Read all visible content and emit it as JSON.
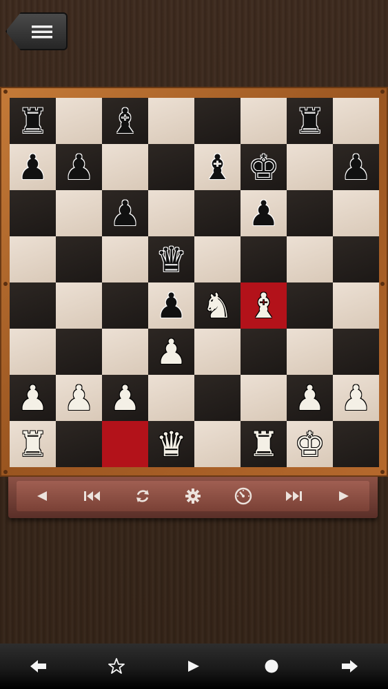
{
  "menu": {
    "icon": "hamburger-menu-icon"
  },
  "board": {
    "light_color": "#e5d8c9",
    "dark_color": "#231e1b",
    "highlight_color": "#b3121a",
    "highlights": [
      "f4",
      "c1"
    ],
    "pieces": [
      {
        "square": "a8",
        "color": "b",
        "type": "R",
        "glyph": "♜"
      },
      {
        "square": "c8",
        "color": "b",
        "type": "B",
        "glyph": "♝"
      },
      {
        "square": "g8",
        "color": "b",
        "type": "R",
        "glyph": "♜"
      },
      {
        "square": "a7",
        "color": "b",
        "type": "P",
        "glyph": "♟"
      },
      {
        "square": "b7",
        "color": "b",
        "type": "P",
        "glyph": "♟"
      },
      {
        "square": "e7",
        "color": "b",
        "type": "B",
        "glyph": "♝"
      },
      {
        "square": "f7",
        "color": "b",
        "type": "K",
        "glyph": "♚"
      },
      {
        "square": "h7",
        "color": "b",
        "type": "P",
        "glyph": "♟"
      },
      {
        "square": "c6",
        "color": "b",
        "type": "P",
        "glyph": "♟"
      },
      {
        "square": "f6",
        "color": "b",
        "type": "P",
        "glyph": "♟"
      },
      {
        "square": "d5",
        "color": "b",
        "type": "Q",
        "glyph": "♛"
      },
      {
        "square": "d4",
        "color": "b",
        "type": "P",
        "glyph": "♟"
      },
      {
        "square": "e4",
        "color": "w",
        "type": "N",
        "glyph": "♞"
      },
      {
        "square": "f4",
        "color": "w",
        "type": "B",
        "glyph": "♝"
      },
      {
        "square": "d3",
        "color": "w",
        "type": "P",
        "glyph": "♟"
      },
      {
        "square": "a2",
        "color": "w",
        "type": "P",
        "glyph": "♟"
      },
      {
        "square": "b2",
        "color": "w",
        "type": "P",
        "glyph": "♟"
      },
      {
        "square": "c2",
        "color": "w",
        "type": "P",
        "glyph": "♟"
      },
      {
        "square": "g2",
        "color": "w",
        "type": "P",
        "glyph": "♟"
      },
      {
        "square": "h2",
        "color": "w",
        "type": "P",
        "glyph": "♟"
      },
      {
        "square": "a1",
        "color": "w",
        "type": "R",
        "glyph": "♜"
      },
      {
        "square": "d1",
        "color": "w",
        "type": "Q",
        "glyph": "♛"
      },
      {
        "square": "f1",
        "color": "w",
        "type": "R",
        "glyph": "♜"
      },
      {
        "square": "g1",
        "color": "w",
        "type": "K",
        "glyph": "♚"
      }
    ]
  },
  "toolbar": {
    "buttons": [
      {
        "name": "previous-move-button",
        "icon": "triangle-left-icon"
      },
      {
        "name": "first-move-button",
        "icon": "skip-to-start-icon"
      },
      {
        "name": "flip-board-button",
        "icon": "rotate-arrows-icon"
      },
      {
        "name": "settings-button",
        "icon": "gear-icon"
      },
      {
        "name": "engine-strength-button",
        "icon": "speedometer-icon"
      },
      {
        "name": "last-move-button",
        "icon": "skip-to-end-icon"
      },
      {
        "name": "next-move-button",
        "icon": "triangle-right-icon"
      }
    ]
  },
  "navbar": {
    "buttons": [
      {
        "name": "back-arrow-button",
        "icon": "arrow-left-icon"
      },
      {
        "name": "favorite-button",
        "icon": "star-outline-icon"
      },
      {
        "name": "play-button",
        "icon": "play-icon"
      },
      {
        "name": "home-button",
        "icon": "circle-icon"
      },
      {
        "name": "forward-arrow-button",
        "icon": "arrow-right-icon"
      }
    ]
  }
}
